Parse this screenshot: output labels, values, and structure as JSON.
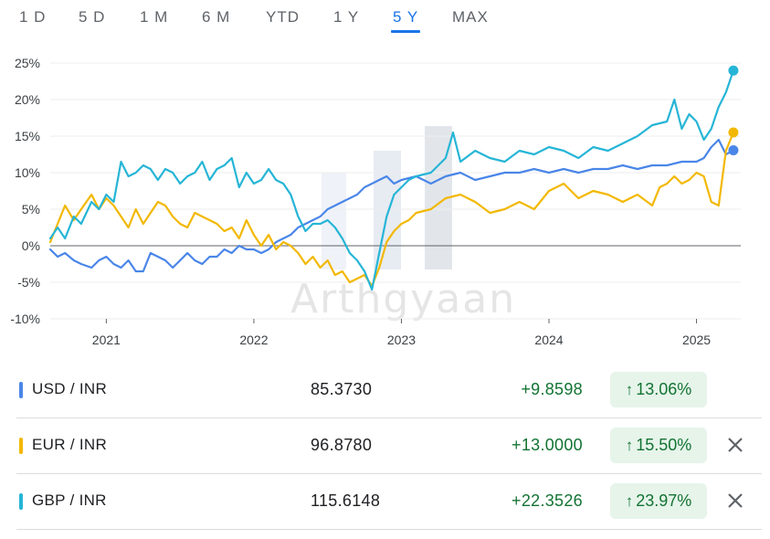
{
  "tabs": [
    {
      "label": "1 D",
      "active": false
    },
    {
      "label": "5 D",
      "active": false
    },
    {
      "label": "1 M",
      "active": false
    },
    {
      "label": "6 M",
      "active": false
    },
    {
      "label": "YTD",
      "active": false
    },
    {
      "label": "1 Y",
      "active": false
    },
    {
      "label": "5 Y",
      "active": true
    },
    {
      "label": "MAX",
      "active": false
    }
  ],
  "watermark": "Arthgyaan",
  "chart_data": {
    "type": "line",
    "ylim": [
      -10,
      25
    ],
    "yticks": [
      25,
      20,
      15,
      10,
      5,
      0,
      -5,
      -10
    ],
    "ytick_labels": [
      "25%",
      "20%",
      "15%",
      "10%",
      "5%",
      "0%",
      "-5%",
      "-10%"
    ],
    "xlim": [
      2020.62,
      2025.3
    ],
    "xticks": [
      2021,
      2022,
      2023,
      2024,
      2025
    ],
    "xtick_labels": [
      "2021",
      "2022",
      "2023",
      "2024",
      "2025"
    ],
    "grid": true,
    "series": [
      {
        "name": "USD / INR",
        "color": "#4a86e8",
        "x": [
          2020.62,
          2020.67,
          2020.72,
          2020.78,
          2020.83,
          2020.9,
          2020.95,
          2021.0,
          2021.05,
          2021.1,
          2021.15,
          2021.2,
          2021.25,
          2021.3,
          2021.35,
          2021.4,
          2021.45,
          2021.5,
          2021.55,
          2021.6,
          2021.65,
          2021.7,
          2021.75,
          2021.8,
          2021.85,
          2021.9,
          2021.95,
          2022.0,
          2022.05,
          2022.1,
          2022.15,
          2022.2,
          2022.25,
          2022.3,
          2022.35,
          2022.4,
          2022.45,
          2022.5,
          2022.55,
          2022.6,
          2022.65,
          2022.7,
          2022.75,
          2022.8,
          2022.85,
          2022.9,
          2022.95,
          2023.0,
          2023.1,
          2023.2,
          2023.3,
          2023.4,
          2023.5,
          2023.6,
          2023.7,
          2023.8,
          2023.9,
          2024.0,
          2024.1,
          2024.2,
          2024.3,
          2024.4,
          2024.5,
          2024.6,
          2024.7,
          2024.8,
          2024.9,
          2025.0,
          2025.05,
          2025.1,
          2025.15,
          2025.2,
          2025.25
        ],
        "y": [
          -0.5,
          -1.5,
          -1.0,
          -2.0,
          -2.5,
          -3.0,
          -2.0,
          -1.5,
          -2.5,
          -3.0,
          -2.0,
          -3.5,
          -3.5,
          -1.0,
          -1.5,
          -2.0,
          -3.0,
          -2.0,
          -1.0,
          -2.0,
          -2.5,
          -1.5,
          -1.5,
          -0.5,
          -1.0,
          0.0,
          -0.5,
          -0.5,
          -1.0,
          -0.5,
          0.5,
          1.0,
          1.5,
          2.5,
          3.0,
          3.5,
          4.0,
          5.0,
          5.5,
          6.0,
          6.5,
          7.0,
          8.0,
          8.5,
          9.0,
          9.5,
          8.5,
          9.0,
          9.5,
          8.5,
          9.5,
          10.0,
          9.0,
          9.5,
          10.0,
          10.0,
          10.5,
          10.0,
          10.5,
          10.0,
          10.5,
          10.5,
          11.0,
          10.5,
          11.0,
          11.0,
          11.5,
          11.5,
          12.0,
          13.5,
          14.5,
          12.5,
          13.06
        ]
      },
      {
        "name": "EUR / INR",
        "color": "#f2b800",
        "x": [
          2020.62,
          2020.67,
          2020.72,
          2020.78,
          2020.83,
          2020.9,
          2020.95,
          2021.0,
          2021.05,
          2021.1,
          2021.15,
          2021.2,
          2021.25,
          2021.3,
          2021.35,
          2021.4,
          2021.45,
          2021.5,
          2021.55,
          2021.6,
          2021.65,
          2021.7,
          2021.75,
          2021.8,
          2021.85,
          2021.9,
          2021.95,
          2022.0,
          2022.05,
          2022.1,
          2022.15,
          2022.2,
          2022.25,
          2022.3,
          2022.35,
          2022.4,
          2022.45,
          2022.5,
          2022.55,
          2022.6,
          2022.65,
          2022.7,
          2022.75,
          2022.8,
          2022.85,
          2022.9,
          2022.95,
          2023.0,
          2023.05,
          2023.1,
          2023.2,
          2023.3,
          2023.4,
          2023.5,
          2023.6,
          2023.7,
          2023.8,
          2023.9,
          2024.0,
          2024.1,
          2024.2,
          2024.3,
          2024.4,
          2024.5,
          2024.6,
          2024.7,
          2024.75,
          2024.8,
          2024.85,
          2024.9,
          2024.95,
          2025.0,
          2025.05,
          2025.1,
          2025.15,
          2025.2,
          2025.25
        ],
        "y": [
          0.5,
          3.0,
          5.5,
          3.5,
          5.0,
          7.0,
          5.0,
          6.5,
          5.5,
          4.0,
          2.5,
          5.0,
          3.0,
          4.5,
          6.0,
          5.5,
          4.0,
          3.0,
          2.5,
          4.5,
          4.0,
          3.5,
          3.0,
          2.0,
          2.5,
          1.0,
          3.5,
          1.5,
          0.0,
          1.5,
          -0.5,
          0.5,
          0.0,
          -1.0,
          -2.5,
          -1.5,
          -3.0,
          -2.0,
          -4.0,
          -3.5,
          -5.0,
          -4.5,
          -4.0,
          -5.5,
          -3.0,
          0.5,
          2.0,
          3.0,
          3.5,
          4.5,
          5.0,
          6.5,
          7.0,
          6.0,
          4.5,
          5.0,
          6.0,
          5.0,
          7.5,
          8.5,
          6.5,
          7.5,
          7.0,
          6.0,
          7.0,
          5.5,
          8.0,
          8.5,
          9.5,
          8.5,
          9.0,
          10.0,
          9.5,
          6.0,
          5.5,
          13.0,
          15.5
        ]
      },
      {
        "name": "GBP / INR",
        "color": "#26b5d6",
        "x": [
          2020.62,
          2020.67,
          2020.72,
          2020.78,
          2020.83,
          2020.9,
          2020.95,
          2021.0,
          2021.05,
          2021.1,
          2021.15,
          2021.2,
          2021.25,
          2021.3,
          2021.35,
          2021.4,
          2021.45,
          2021.5,
          2021.55,
          2021.6,
          2021.65,
          2021.7,
          2021.75,
          2021.8,
          2021.85,
          2021.9,
          2021.95,
          2022.0,
          2022.05,
          2022.1,
          2022.15,
          2022.2,
          2022.25,
          2022.3,
          2022.35,
          2022.4,
          2022.45,
          2022.5,
          2022.55,
          2022.6,
          2022.65,
          2022.7,
          2022.75,
          2022.8,
          2022.85,
          2022.9,
          2022.95,
          2023.0,
          2023.05,
          2023.1,
          2023.2,
          2023.3,
          2023.35,
          2023.4,
          2023.5,
          2023.6,
          2023.7,
          2023.8,
          2023.9,
          2024.0,
          2024.1,
          2024.2,
          2024.3,
          2024.4,
          2024.5,
          2024.6,
          2024.7,
          2024.8,
          2024.85,
          2024.9,
          2024.95,
          2025.0,
          2025.05,
          2025.1,
          2025.15,
          2025.2,
          2025.25
        ],
        "y": [
          1.0,
          2.5,
          1.0,
          4.0,
          3.0,
          6.0,
          5.0,
          7.0,
          6.0,
          11.5,
          9.5,
          10.0,
          11.0,
          10.5,
          9.0,
          10.5,
          10.0,
          8.5,
          9.5,
          10.0,
          11.5,
          9.0,
          10.5,
          11.0,
          12.0,
          8.0,
          10.0,
          8.5,
          9.0,
          10.5,
          9.0,
          8.5,
          7.0,
          4.0,
          2.0,
          3.0,
          3.0,
          3.5,
          2.5,
          1.0,
          -1.0,
          -2.0,
          -3.5,
          -6.0,
          -1.0,
          4.0,
          7.0,
          8.0,
          9.0,
          9.5,
          10.0,
          12.0,
          15.5,
          11.5,
          13.0,
          12.0,
          11.5,
          13.0,
          12.5,
          13.5,
          13.0,
          12.0,
          13.5,
          13.0,
          14.0,
          15.0,
          16.5,
          17.0,
          20.0,
          16.0,
          18.0,
          17.0,
          14.5,
          16.0,
          19.0,
          21.0,
          23.97
        ]
      }
    ]
  },
  "rows": [
    {
      "pair": "USD / INR",
      "price": "85.3730",
      "change": "+9.8598",
      "pct": "13.06%",
      "color": "#4a86e8",
      "closable": false
    },
    {
      "pair": "EUR / INR",
      "price": "96.8780",
      "change": "+13.0000",
      "pct": "15.50%",
      "color": "#f2b800",
      "closable": true
    },
    {
      "pair": "GBP / INR",
      "price": "115.6148",
      "change": "+22.3526",
      "pct": "23.97%",
      "color": "#26b5d6",
      "closable": true
    }
  ],
  "icons": {
    "up": "arrow-up-icon",
    "close": "close-icon"
  }
}
